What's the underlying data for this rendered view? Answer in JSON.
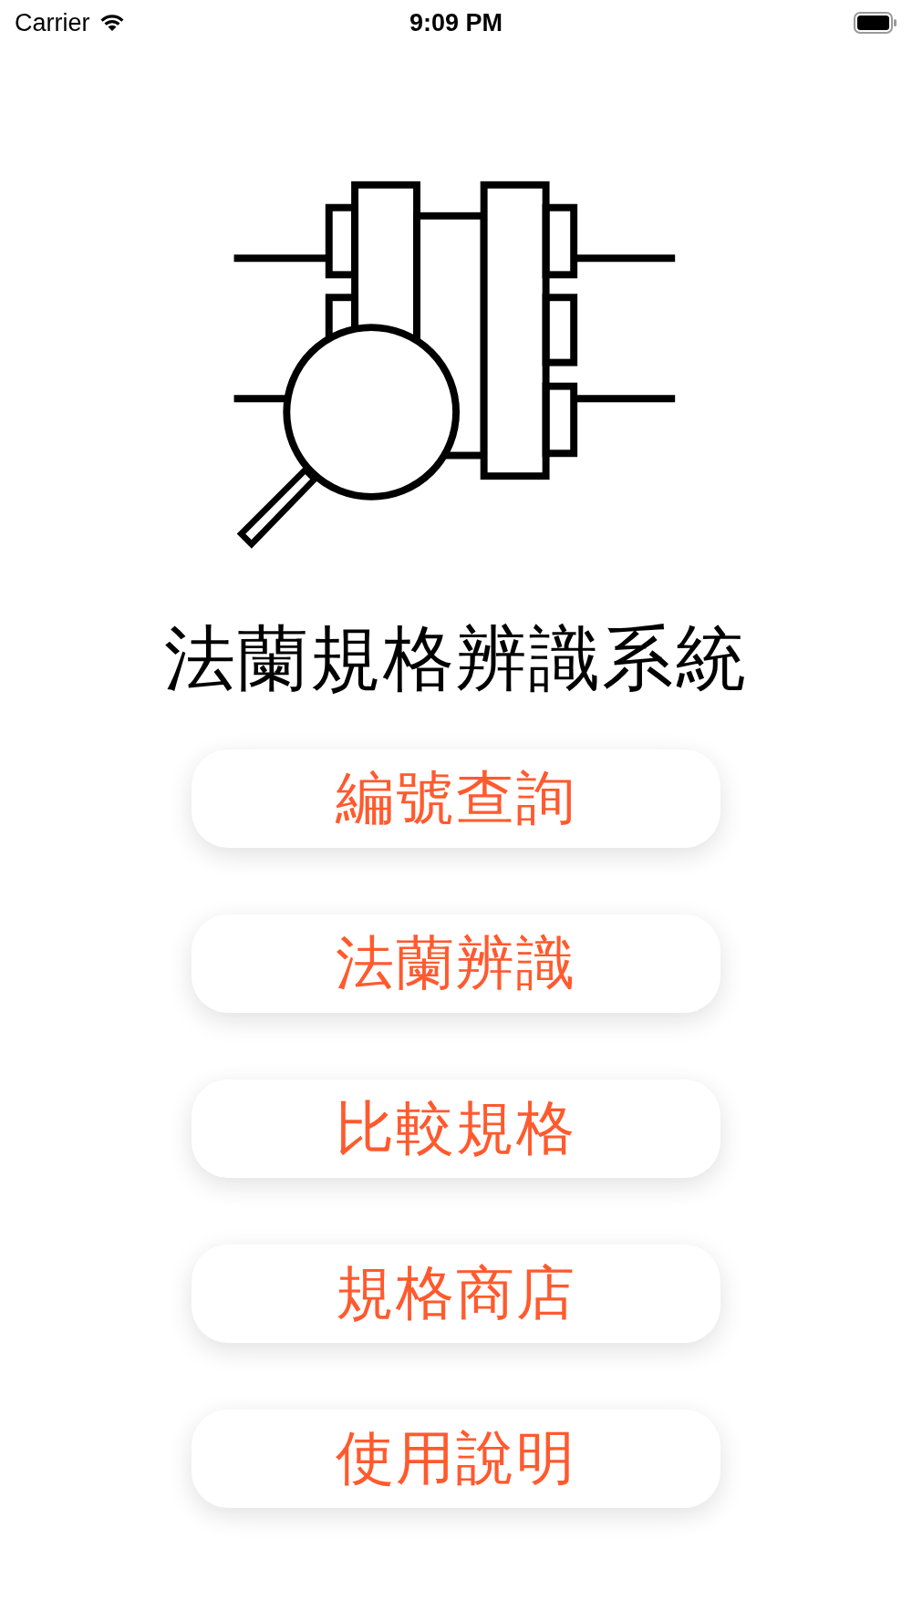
{
  "status_bar": {
    "carrier": "Carrier",
    "time": "9:09 PM"
  },
  "title": "法蘭規格辨識系統",
  "buttons": [
    {
      "label": "編號查詢"
    },
    {
      "label": "法蘭辨識"
    },
    {
      "label": "比較規格"
    },
    {
      "label": "規格商店"
    },
    {
      "label": "使用說明"
    }
  ]
}
